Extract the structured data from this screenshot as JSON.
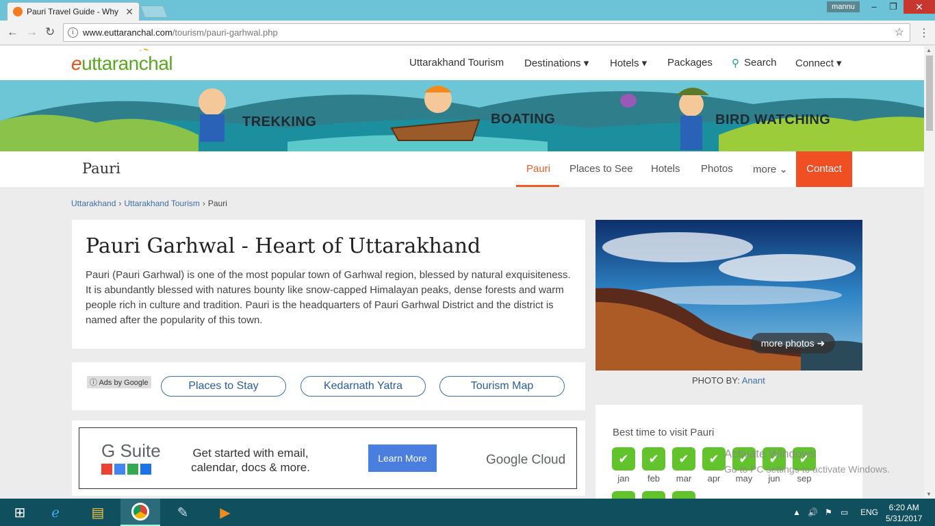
{
  "browser": {
    "tab_title": "Pauri Travel Guide - Why",
    "user": "mannu",
    "url_domain": "www.euttaranchal.com",
    "url_path": "/tourism/pauri-garhwal.php"
  },
  "site": {
    "logo_e": "e",
    "logo_rest": "uttaranchal",
    "nav": [
      "Uttarakhand Tourism",
      "Destinations ▾",
      "Hotels ▾",
      "Packages",
      "Search",
      "Connect ▾"
    ]
  },
  "banner": {
    "labels": [
      "TREKKING",
      "BOATING",
      "BIRD WATCHING"
    ]
  },
  "subnav": {
    "title": "Pauri",
    "items": [
      "Pauri",
      "Places to See",
      "Hotels",
      "Photos",
      "more ⌄"
    ],
    "contact": "Contact"
  },
  "breadcrumb": {
    "items": [
      "Uttarakhand",
      "Uttarakhand Tourism",
      "Pauri"
    ]
  },
  "main": {
    "heading": "Pauri Garhwal - Heart of Uttarakhand",
    "intro": "Pauri (Pauri Garhwal) is one of the most popular town of Garhwal region, blessed by natural exquisiteness. It is abundantly blessed with natures bounty like snow-capped Himalayan peaks, dense forests and warm people rich in culture and tradition. Pauri is the headquarters of Pauri Garhwal District and the district is named after the popularity of this town."
  },
  "ads": {
    "label": "Ads by Google",
    "links": [
      "Places to Stay",
      "Kedarnath Yatra",
      "Tourism Map"
    ]
  },
  "gsuite_ad": {
    "logo": "G Suite",
    "text": "Get started with email, calendar, docs & more.",
    "button": "Learn More",
    "brand": "Google Cloud"
  },
  "photo": {
    "more": "more photos",
    "credit_label": "PHOTO BY:",
    "credit_name": "Anant"
  },
  "best_time": {
    "title": "Best time to visit Pauri",
    "months": [
      "jan",
      "feb",
      "mar",
      "apr",
      "may",
      "jun",
      "sep"
    ]
  },
  "watermark": {
    "line1": "Activate Windows",
    "line2": "Go to PC settings to activate Windows."
  },
  "taskbar": {
    "lang": "ENG",
    "time": "6:20 AM",
    "date": "5/31/2017"
  }
}
